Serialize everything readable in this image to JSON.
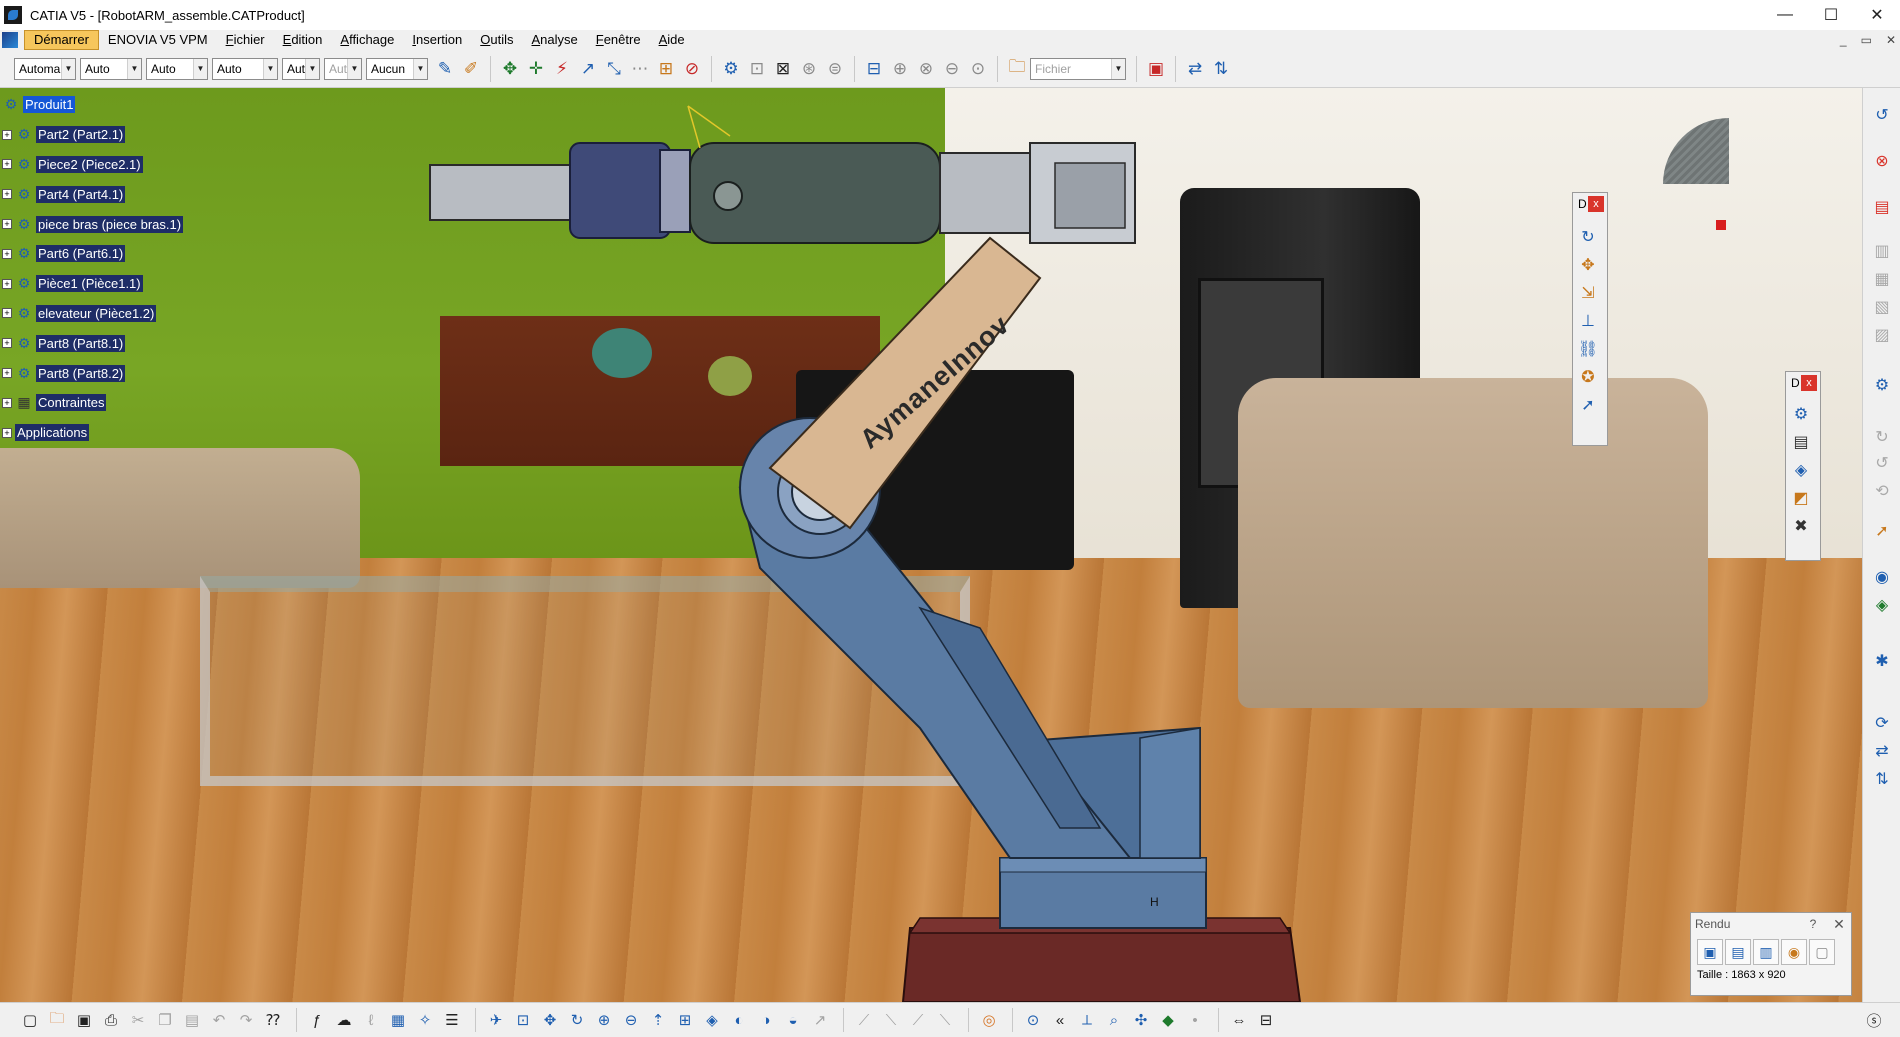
{
  "window": {
    "title": "CATIA V5 - [RobotARM_assemble.CATProduct]",
    "controls": {
      "minimize": "—",
      "maximize": "☐",
      "close": "✕"
    }
  },
  "menu": {
    "items": [
      "Démarrer",
      "ENOVIA V5 VPM",
      "Fichier",
      "Edition",
      "Affichage",
      "Insertion",
      "Outils",
      "Analyse",
      "Fenêtre",
      "Aide"
    ],
    "active_index": 0,
    "mdi_controls": [
      "_",
      "▭",
      "✕"
    ]
  },
  "toolbar": {
    "combos": [
      {
        "value": "Automa",
        "disabled": false
      },
      {
        "value": "Auto",
        "disabled": false
      },
      {
        "value": "Auto",
        "disabled": false
      },
      {
        "value": "Auto",
        "disabled": false
      },
      {
        "value": "Aut",
        "disabled": false
      },
      {
        "value": "Aut",
        "disabled": true
      },
      {
        "value": "Aucun",
        "disabled": false
      }
    ],
    "file_combo": {
      "value": "Fichier",
      "disabled": true
    },
    "icons": [
      "paint-brush-icon",
      "painter-icon",
      "move-compass-icon",
      "snap-icon",
      "explode-icon",
      "manipulation-icon",
      "stop-manip-icon",
      "fix-icon",
      "bill-of-materials-icon",
      "catalog-icon",
      "measure-icon",
      "clash-icon",
      "section-icon",
      "distance-icon",
      "open-folder-icon",
      "save-management-icon",
      "view-icon"
    ]
  },
  "tree": {
    "root": "Produit1",
    "items": [
      {
        "label": "Part2 (Part2.1)",
        "type": "part"
      },
      {
        "label": "Piece2 (Piece2.1)",
        "type": "part"
      },
      {
        "label": "Part4 (Part4.1)",
        "type": "part"
      },
      {
        "label": "piece bras (piece bras.1)",
        "type": "part"
      },
      {
        "label": "Part6 (Part6.1)",
        "type": "part"
      },
      {
        "label": "Pièce1 (Pièce1.1)",
        "type": "part"
      },
      {
        "label": "elevateur (Pièce1.2)",
        "type": "part"
      },
      {
        "label": "Part8 (Part8.1)",
        "type": "part"
      },
      {
        "label": "Part8 (Part8.2)",
        "type": "part"
      },
      {
        "label": "Contraintes",
        "type": "constraints"
      },
      {
        "label": "Applications",
        "type": "applications"
      }
    ]
  },
  "viewport": {
    "arm_engraving": "AymaneInnov",
    "base_marker": "H"
  },
  "float_toolbars": [
    {
      "title": "D",
      "close": "x",
      "buttons": 7
    },
    {
      "title": "D",
      "close": "x",
      "buttons": 5
    }
  ],
  "render_dialog": {
    "title": "Rendu",
    "help": "?",
    "close": "✕",
    "size_text": "Taille : 1863 x 920"
  },
  "colors": {
    "tree_label_bg": "#1e2d66",
    "tree_root_bg": "#1557d6",
    "menu_active_bg": "#f6c65c",
    "arm_blue": "#5a7ba3",
    "arm_tan": "#d9b792",
    "base_maroon": "#6a2926"
  }
}
